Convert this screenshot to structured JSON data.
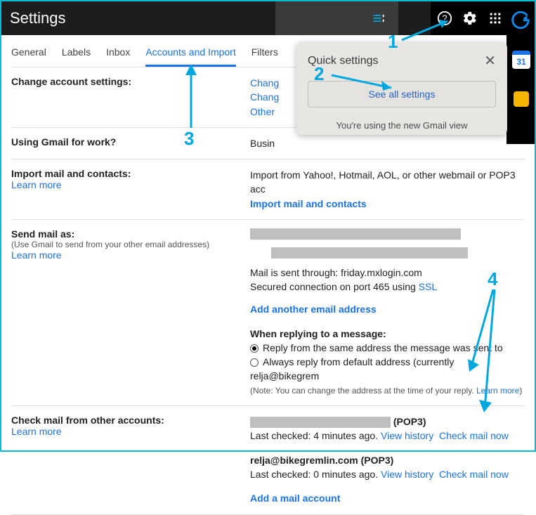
{
  "header": {
    "title": "Settings"
  },
  "tabs": {
    "general": "General",
    "labels": "Labels",
    "inbox": "Inbox",
    "accounts": "Accounts and Import",
    "filters": "Filters"
  },
  "panel": {
    "title": "Quick settings",
    "see_all": "See all settings",
    "footer": "You're using the new Gmail view"
  },
  "sections": {
    "change_account": {
      "label": "Change account settings:",
      "r1": "Chang",
      "r2": "Chang",
      "r3": "Other"
    },
    "work": {
      "label": "Using Gmail for work?",
      "r": "Busin"
    },
    "import": {
      "label": "Import mail and contacts:",
      "learn": "Learn more",
      "desc": "Import from Yahoo!, Hotmail, AOL, or other webmail or POP3 acc",
      "link": "Import mail and contacts"
    },
    "send_as": {
      "label": "Send mail as:",
      "sub": "(Use Gmail to send from your other email addresses)",
      "learn": "Learn more",
      "mail_through": "Mail is sent through: friday.mxlogin.com",
      "secured_pre": "Secured connection on port 465 using ",
      "ssl": "SSL",
      "add": "Add another email address",
      "reply_label": "When replying to a message:",
      "opt1": "Reply from the same address the message was sent to",
      "opt2": "Always reply from default address (currently relja@bikegrem",
      "note_pre": "(Note: You can change the address at the time of your reply. ",
      "note_link": "Learn more",
      "note_post": ")"
    },
    "check": {
      "label": "Check mail from other accounts:",
      "learn": "Learn more",
      "acc1_suffix": " (POP3)",
      "acc1_status": "Last checked: 4 minutes ago. ",
      "acc2_name": "relja@bikegremlin.com (POP3)",
      "acc2_status": "Last checked: 0 minutes ago. ",
      "view_history": "View history",
      "check_now": "Check mail now",
      "add": "Add a mail account"
    }
  },
  "cal_day": "31",
  "anno": {
    "n1": "1",
    "n2": "2",
    "n3": "3",
    "n4": "4"
  }
}
